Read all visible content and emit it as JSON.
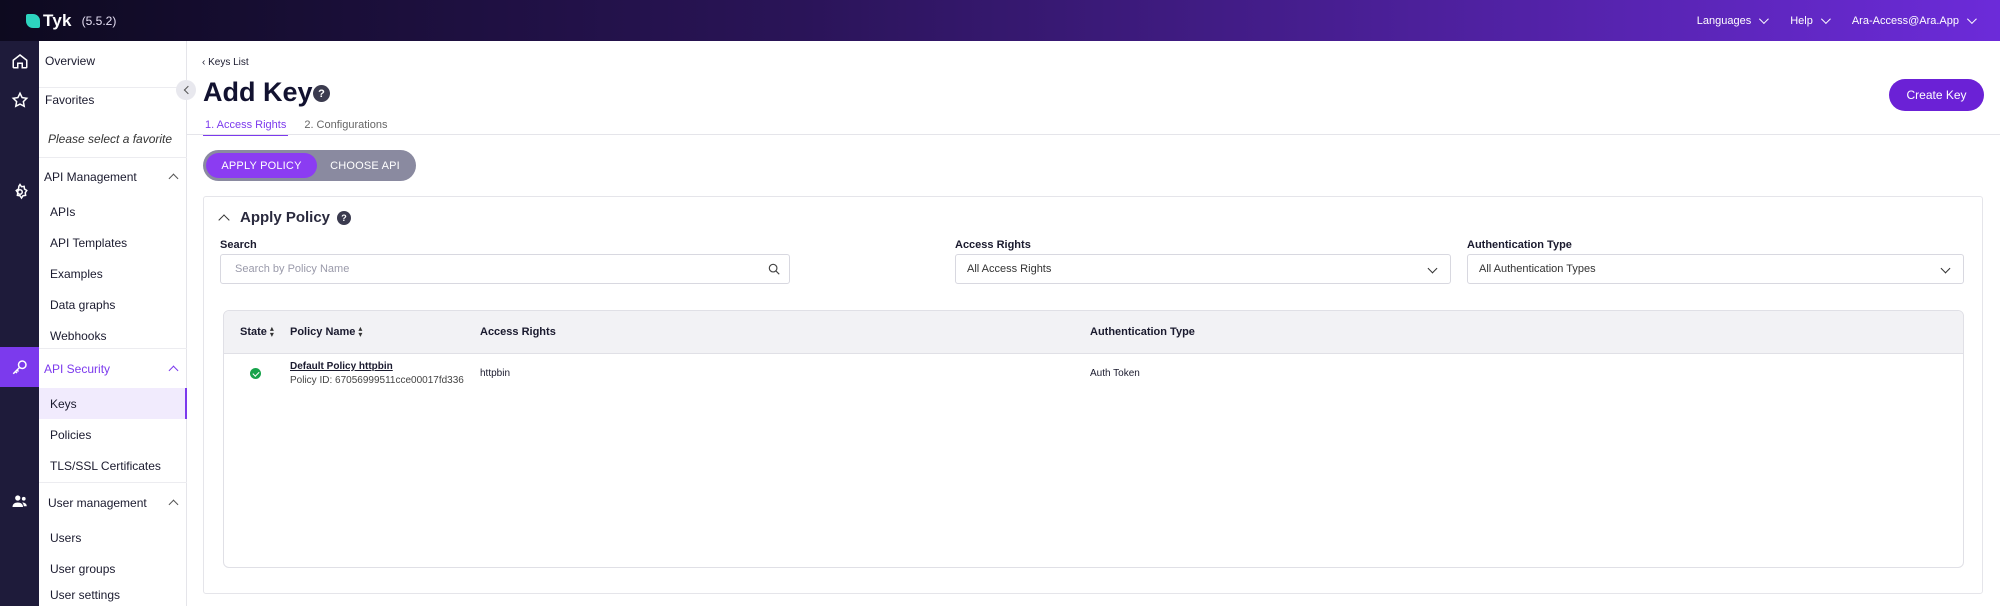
{
  "brand": {
    "name": "Tyk",
    "version": "(5.5.2)"
  },
  "topnav": {
    "languages": "Languages",
    "help": "Help",
    "account": "Ara-Access@Ara.App"
  },
  "sidebar": {
    "overview": "Overview",
    "favorites": "Favorites",
    "favorites_placeholder": "Please select a favorite",
    "api_management": {
      "title": "API Management",
      "items": [
        "APIs",
        "API Templates",
        "Examples",
        "Data graphs",
        "Webhooks"
      ]
    },
    "api_security": {
      "title": "API Security",
      "items": [
        "Keys",
        "Policies",
        "TLS/SSL Certificates"
      ]
    },
    "user_management": {
      "title": "User management",
      "items": [
        "Users",
        "User groups",
        "User settings"
      ]
    }
  },
  "page": {
    "breadcrumb": "‹ Keys List",
    "title": "Add Key",
    "help": "?",
    "create_button": "Create Key",
    "tabs": [
      "1. Access Rights",
      "2. Configurations"
    ],
    "toggle": {
      "apply": "APPLY POLICY",
      "choose": "CHOOSE API"
    }
  },
  "panel": {
    "title": "Apply Policy",
    "search_label": "Search",
    "search_placeholder": "Search by Policy Name",
    "access_label": "Access Rights",
    "access_value": "All Access Rights",
    "auth_label": "Authentication Type",
    "auth_value": "All Authentication Types"
  },
  "table": {
    "headers": {
      "state": "State",
      "policy_name": "Policy Name",
      "access_rights": "Access Rights",
      "auth_type": "Authentication Type"
    },
    "rows": [
      {
        "name": "Default Policy httpbin",
        "policy_id": "Policy ID: 67056999511cce00017fd336",
        "access_rights": "httpbin",
        "auth_type": "Auth Token",
        "state": "active"
      }
    ]
  },
  "colors": {
    "accent": "#7c3aed",
    "button": "#6b21d6",
    "status_ok": "#16a34a"
  }
}
